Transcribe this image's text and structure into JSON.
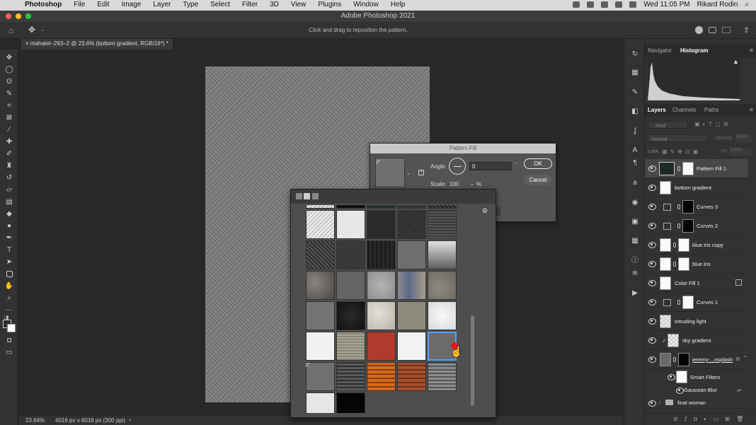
{
  "menubar": {
    "app_name": "Photoshop",
    "items": [
      "File",
      "Edit",
      "Image",
      "Layer",
      "Type",
      "Select",
      "Filter",
      "3D",
      "View",
      "Plugins",
      "Window",
      "Help"
    ],
    "clock": "Wed 11:05 PM",
    "user": "Rikard Rodin"
  },
  "window": {
    "title": "Adobe Photoshop 2021"
  },
  "options_bar": {
    "hint": "Click and drag to reposition the pattern."
  },
  "document_tab": {
    "label": "mahalet–293–2 @ 23.6% (bottom gradient, RGB/16*) *"
  },
  "status_bar": {
    "zoom": "23.64%",
    "doc_info": "4016 px x 6016 px (300 ppi)"
  },
  "panels": {
    "top_tabs": [
      "Navigator",
      "Histogram"
    ],
    "active_top_tab": "Histogram",
    "layer_tabs": [
      "Layers",
      "Channels",
      "Paths"
    ],
    "active_layer_tab": "Layers",
    "kind_placeholder": "Kind",
    "blend_mode": "Normal",
    "opacity_label": "Opacity:",
    "opacity_value": "100%",
    "lock_label": "Lock:",
    "fill_label": "Fill:",
    "fill_value": "100%"
  },
  "layers": [
    {
      "name": "Pattern Fill 1",
      "selected": true
    },
    {
      "name": "bottom gradient"
    },
    {
      "name": "Curves 3"
    },
    {
      "name": "Curves 2"
    },
    {
      "name": "blue iris copy"
    },
    {
      "name": "blue iris"
    },
    {
      "name": "Color Fill 1"
    },
    {
      "name": "Curves 1"
    },
    {
      "name": "intruding light"
    },
    {
      "name": "sky gradient"
    },
    {
      "name": "jeremy-...nsplash"
    },
    {
      "name": "Smart Filters"
    },
    {
      "name": "Gaussian Blur"
    },
    {
      "name": "final woman"
    }
  ],
  "pattern_fill_dialog": {
    "title": "Pattern Fill",
    "angle_label": "Angle:",
    "angle_value": "0",
    "angle_unit": "°",
    "scale_label": "Scale:",
    "scale_value": "100",
    "scale_unit": "%",
    "ok_label": "OK",
    "cancel_label": "Cancel"
  },
  "pattern_picker": {
    "selected_index": 24
  },
  "colors": {
    "selection_blue": "#4da3ff",
    "cursor_red": "#e01b1b"
  }
}
